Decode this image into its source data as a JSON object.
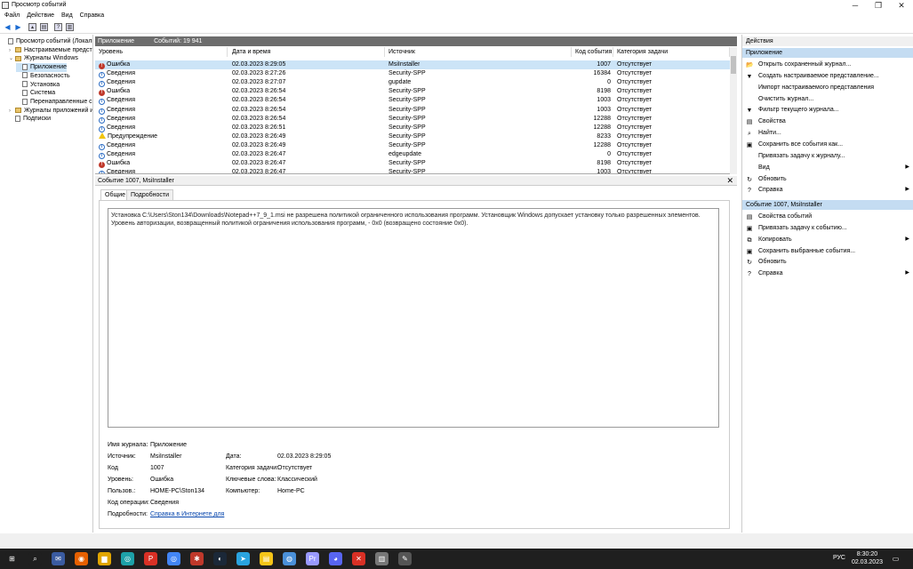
{
  "window": {
    "title": "Просмотр событий",
    "minimize": "─",
    "maximize": "❐",
    "close": "✕"
  },
  "menu": [
    "Файл",
    "Действие",
    "Вид",
    "Справка"
  ],
  "tree": [
    {
      "label": "Просмотр событий (Локальн",
      "indent": 0,
      "expander": "",
      "type": "root"
    },
    {
      "label": "Настраиваемые представл",
      "indent": 1,
      "expander": "›",
      "type": "folder"
    },
    {
      "label": "Журналы Windows",
      "indent": 1,
      "expander": "⌄",
      "type": "folder"
    },
    {
      "label": "Приложение",
      "indent": 2,
      "expander": "",
      "type": "log",
      "selected": true
    },
    {
      "label": "Безопасность",
      "indent": 2,
      "expander": "",
      "type": "log"
    },
    {
      "label": "Установка",
      "indent": 2,
      "expander": "",
      "type": "log"
    },
    {
      "label": "Система",
      "indent": 2,
      "expander": "",
      "type": "log"
    },
    {
      "label": "Перенаправленные соб",
      "indent": 2,
      "expander": "",
      "type": "log"
    },
    {
      "label": "Журналы приложений и сл",
      "indent": 1,
      "expander": "›",
      "type": "folder"
    },
    {
      "label": "Подписки",
      "indent": 1,
      "expander": "",
      "type": "log"
    }
  ],
  "events_header": {
    "name": "Приложение",
    "count": "Событий: 19 941"
  },
  "columns": [
    "Уровень",
    "Дата и время",
    "Источник",
    "Код события",
    "Категория задачи"
  ],
  "events": [
    {
      "level": "Ошибка",
      "kind": "err",
      "date": "02.03.2023 8:29:05",
      "source": "MsiInstaller",
      "code": "1007",
      "category": "Отсутствует",
      "selected": true
    },
    {
      "level": "Сведения",
      "kind": "info",
      "date": "02.03.2023 8:27:26",
      "source": "Security-SPP",
      "code": "16384",
      "category": "Отсутствует"
    },
    {
      "level": "Сведения",
      "kind": "info",
      "date": "02.03.2023 8:27:07",
      "source": "gupdate",
      "code": "0",
      "category": "Отсутствует"
    },
    {
      "level": "Ошибка",
      "kind": "err",
      "date": "02.03.2023 8:26:54",
      "source": "Security-SPP",
      "code": "8198",
      "category": "Отсутствует"
    },
    {
      "level": "Сведения",
      "kind": "info",
      "date": "02.03.2023 8:26:54",
      "source": "Security-SPP",
      "code": "1003",
      "category": "Отсутствует"
    },
    {
      "level": "Сведения",
      "kind": "info",
      "date": "02.03.2023 8:26:54",
      "source": "Security-SPP",
      "code": "1003",
      "category": "Отсутствует"
    },
    {
      "level": "Сведения",
      "kind": "info",
      "date": "02.03.2023 8:26:54",
      "source": "Security-SPP",
      "code": "12288",
      "category": "Отсутствует"
    },
    {
      "level": "Сведения",
      "kind": "info",
      "date": "02.03.2023 8:26:51",
      "source": "Security-SPP",
      "code": "12288",
      "category": "Отсутствует"
    },
    {
      "level": "Предупреждение",
      "kind": "warn",
      "date": "02.03.2023 8:26:49",
      "source": "Security-SPP",
      "code": "8233",
      "category": "Отсутствует"
    },
    {
      "level": "Сведения",
      "kind": "info",
      "date": "02.03.2023 8:26:49",
      "source": "Security-SPP",
      "code": "12288",
      "category": "Отсутствует"
    },
    {
      "level": "Сведения",
      "kind": "info",
      "date": "02.03.2023 8:26:47",
      "source": "edgeupdate",
      "code": "0",
      "category": "Отсутствует"
    },
    {
      "level": "Ошибка",
      "kind": "err",
      "date": "02.03.2023 8:26:47",
      "source": "Security-SPP",
      "code": "8198",
      "category": "Отсутствует"
    },
    {
      "level": "Сведения",
      "kind": "info",
      "date": "02.03.2023 8:26:47",
      "source": "Security-SPP",
      "code": "1003",
      "category": "Отсутствует"
    }
  ],
  "detail": {
    "header": "Событие 1007, MsiInstaller",
    "close": "✕",
    "tabs": [
      "Общие",
      "Подробности"
    ],
    "description": "Установка C:\\Users\\Ston134\\Downloads\\Notepad++7_9_1.msi не разрешена политикой ограниченного использования программ. Установщик Windows допускает установку только разрешенных элементов. Уровень авторизации, возвращенный политикой ограничения использования программ, - 0x0 (возвращено состояние 0x0).",
    "fields": {
      "log_name_label": "Имя журнала:",
      "log_name": "Приложение",
      "source_label": "Источник:",
      "source": "MsiInstaller",
      "date_label": "Дата:",
      "date": "02.03.2023 8:29:05",
      "code_label": "Код",
      "code": "1007",
      "task_label": "Категория задачи:",
      "task": "Отсутствует",
      "level_label": "Уровень:",
      "level": "Ошибка",
      "keywords_label": "Ключевые слова:",
      "keywords": "Классический",
      "user_label": "Пользов.:",
      "user": "HOME-PC\\Ston134",
      "computer_label": "Компьютер:",
      "computer": "Home-PC",
      "opcode_label": "Код операции:",
      "opcode": "Сведения",
      "more_label": "Подробности:",
      "more_link": "Справка в Интернете для"
    }
  },
  "actions": {
    "title": "Действия",
    "section1": "Приложение",
    "items1": [
      {
        "label": "Открыть сохраненный журнал...",
        "icon": "📂",
        "arrow": ""
      },
      {
        "label": "Создать настраиваемое представление...",
        "icon": "▼",
        "arrow": ""
      },
      {
        "label": "Импорт настраиваемого представления",
        "icon": "",
        "arrow": ""
      },
      {
        "label": "Очистить журнал...",
        "icon": "",
        "arrow": ""
      },
      {
        "label": "Фильтр текущего журнала...",
        "icon": "▼",
        "arrow": ""
      },
      {
        "label": "Свойства",
        "icon": "▤",
        "arrow": ""
      },
      {
        "label": "Найти...",
        "icon": "⌕",
        "arrow": ""
      },
      {
        "label": "Сохранить все события как...",
        "icon": "▣",
        "arrow": ""
      },
      {
        "label": "Привязать задачу к журналу...",
        "icon": "",
        "arrow": ""
      },
      {
        "label": "Вид",
        "icon": "",
        "arrow": "▶"
      },
      {
        "label": "Обновить",
        "icon": "↻",
        "arrow": ""
      },
      {
        "label": "Справка",
        "icon": "?",
        "arrow": "▶"
      }
    ],
    "section2": "Событие 1007, MsiInstaller",
    "items2": [
      {
        "label": "Свойства событий",
        "icon": "▤",
        "arrow": ""
      },
      {
        "label": "Привязать задачу к событию...",
        "icon": "▣",
        "arrow": ""
      },
      {
        "label": "Копировать",
        "icon": "⧉",
        "arrow": "▶"
      },
      {
        "label": "Сохранить выбранные события...",
        "icon": "▣",
        "arrow": ""
      },
      {
        "label": "Обновить",
        "icon": "↻",
        "arrow": ""
      },
      {
        "label": "Справка",
        "icon": "?",
        "arrow": "▶"
      }
    ]
  },
  "taskbar": {
    "lang": "РУС",
    "time": "8:30:20",
    "date": "02.03.2023",
    "apps": [
      "windows-icon",
      "search-icon",
      "mail-icon",
      "firefox-icon",
      "files-icon",
      "chrome-icon",
      "app-p-icon",
      "chrome2-icon",
      "game-icon",
      "steam-icon",
      "telegram-icon",
      "notes-icon",
      "browser-icon",
      "premiere-icon",
      "discord-icon",
      "tool-icon",
      "eventviewer-icon",
      "extra-icon"
    ]
  },
  "colors": {
    "selection": "#cce4f7",
    "section": "#c4dcf2",
    "pane_header": "#6d6d6d",
    "error": "#c0392b",
    "info": "#2d6dc4",
    "warn": "#f1c40f"
  }
}
